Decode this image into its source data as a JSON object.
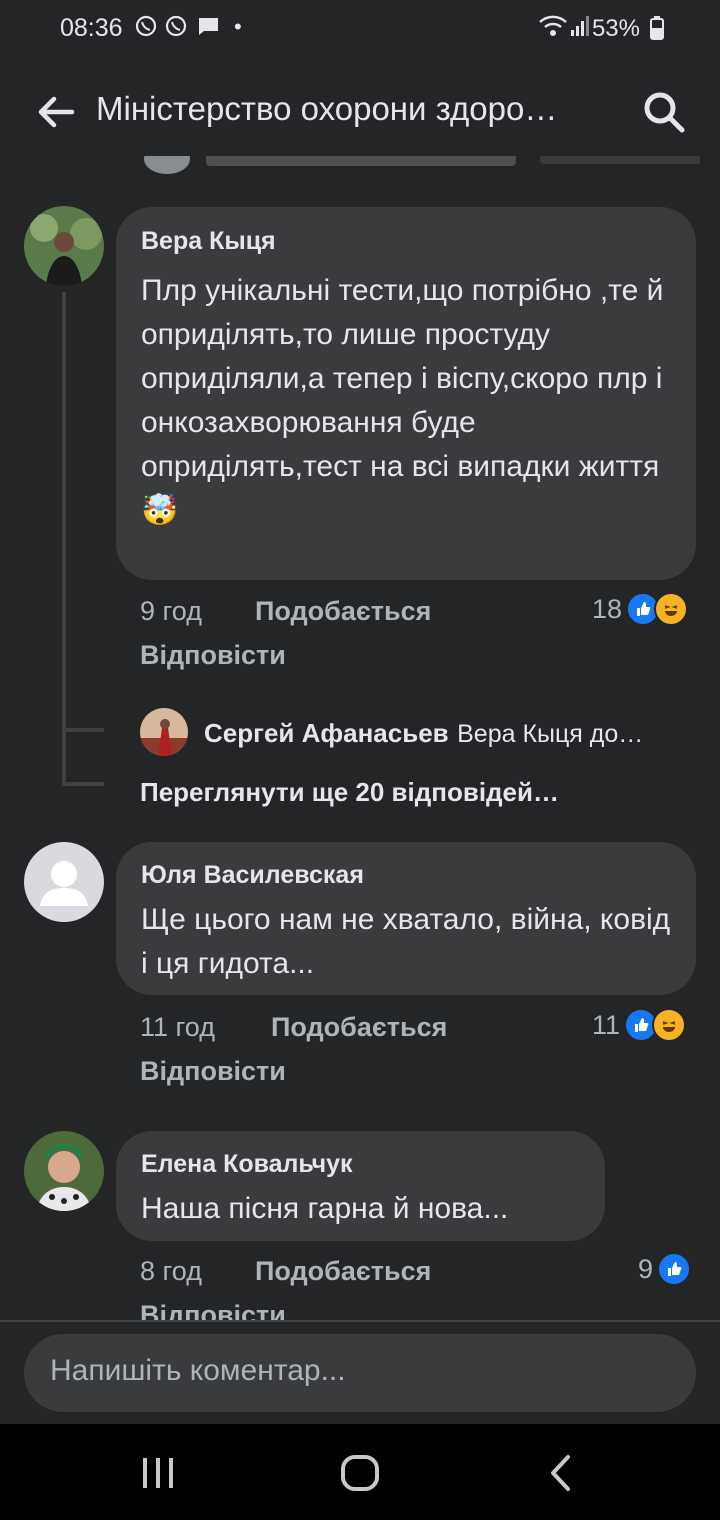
{
  "status_bar": {
    "time": "08:36",
    "battery": "53%"
  },
  "header": {
    "title": "Міністерство охорони здоро…"
  },
  "comments": [
    {
      "author": "Вера Кыця",
      "text": "Плр унікальні тести,що потрібно ,те й оприділять,то лише простуду оприділяли,а тепер і віспу,скоро плр і онкозахворювання  буде оприділять,тест на всі випадки життя",
      "emoji": "🤯",
      "time": "9 год",
      "like_label": "Подобається",
      "reply_label": "Відповісти",
      "reactions": "18"
    },
    {
      "author": "Юля Василевская",
      "text": "Ще цього нам не хватало, війна, ковід  і ця гидота...",
      "time": "11 год",
      "like_label": "Подобається",
      "reply_label": "Відповісти",
      "reactions": "11"
    },
    {
      "author": "Елена Ковальчук",
      "text": "Наша пісня гарна й нова...",
      "time": "8 год",
      "like_label": "Подобається",
      "reply_label": "Відповісти",
      "reactions": "9"
    }
  ],
  "reply_preview": {
    "author": "Сергей Афанасьев",
    "text": "Вера Кыця до…"
  },
  "more_replies": "Переглянути ще 20 відповідей…",
  "comment_input": {
    "placeholder": "Напишіть коментар..."
  }
}
